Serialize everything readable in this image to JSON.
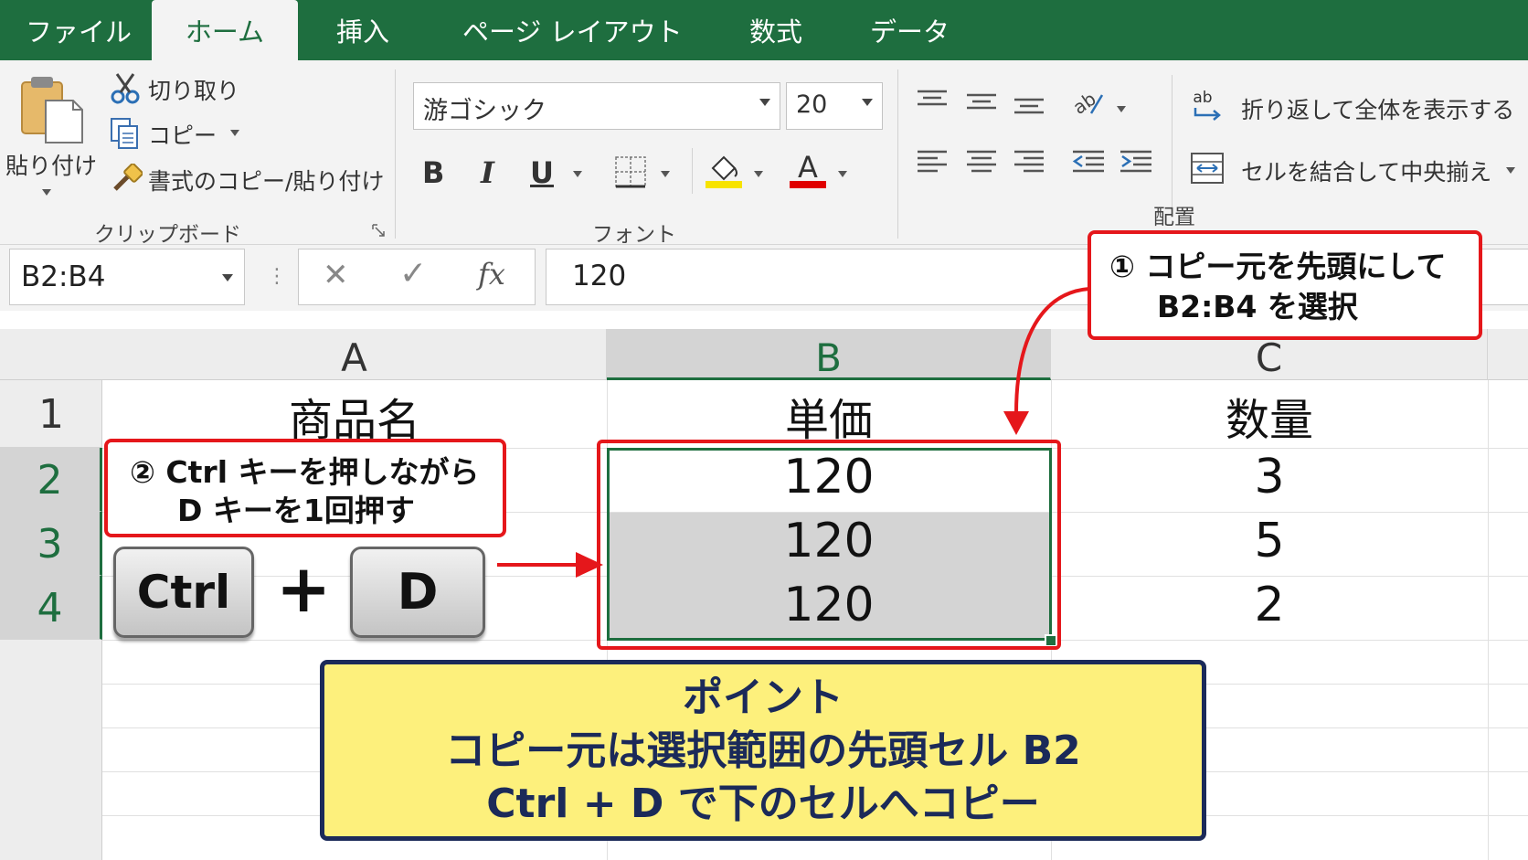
{
  "tabs": [
    {
      "label": "ファイル"
    },
    {
      "label": "ホーム"
    },
    {
      "label": "挿入"
    },
    {
      "label": "ページ レイアウト"
    },
    {
      "label": "数式"
    },
    {
      "label": "データ"
    }
  ],
  "ribbon": {
    "clipboard": {
      "paste_label": "貼り付け",
      "cut_label": "切り取り",
      "copy_label": "コピー",
      "format_painter_label": "書式のコピー/貼り付け",
      "group_label": "クリップボード"
    },
    "font": {
      "font_name": "游ゴシック",
      "font_size": "20",
      "bold": "B",
      "italic": "I",
      "underline": "U",
      "font_color_glyph": "A",
      "group_label": "フォント",
      "fill_color": "#f7e300",
      "text_color": "#e00000"
    },
    "alignment": {
      "wrap_text_label": "折り返して全体を表示する",
      "merge_center_label": "セルを結合して中央揃え",
      "group_label": "配置"
    }
  },
  "formula_bar": {
    "name_box": "B2:B4",
    "cancel_glyph": "✕",
    "enter_glyph": "✓",
    "fx_glyph": "fx",
    "formula": "120"
  },
  "sheet": {
    "columns": [
      "A",
      "B",
      "C"
    ],
    "rows": [
      "1",
      "2",
      "3",
      "4"
    ],
    "cells": [
      [
        "商品名",
        "単価",
        "数量"
      ],
      [
        "",
        "120",
        "3"
      ],
      [
        "",
        "120",
        "5"
      ],
      [
        "",
        "120",
        "2"
      ]
    ]
  },
  "callouts": {
    "step1_line1": "① コピー元を先頭にして",
    "step1_line2": "B2:B4 を選択",
    "step2_line1": "② Ctrl キーを押しながら",
    "step2_line2": "D キーを1回押す",
    "key_ctrl": "Ctrl",
    "key_plus": "+",
    "key_d": "D",
    "point_title": "ポイント",
    "point_line1": "コピー元は選択範囲の先頭セル B2",
    "point_line2": "Ctrl + D で下のセルへコピー"
  },
  "colors": {
    "excel_green": "#1e6e3f",
    "callout_red": "#e5171b",
    "point_fill": "#fdf07c",
    "point_border": "#1b2a59",
    "selection_fill": "#d4d4d4"
  }
}
